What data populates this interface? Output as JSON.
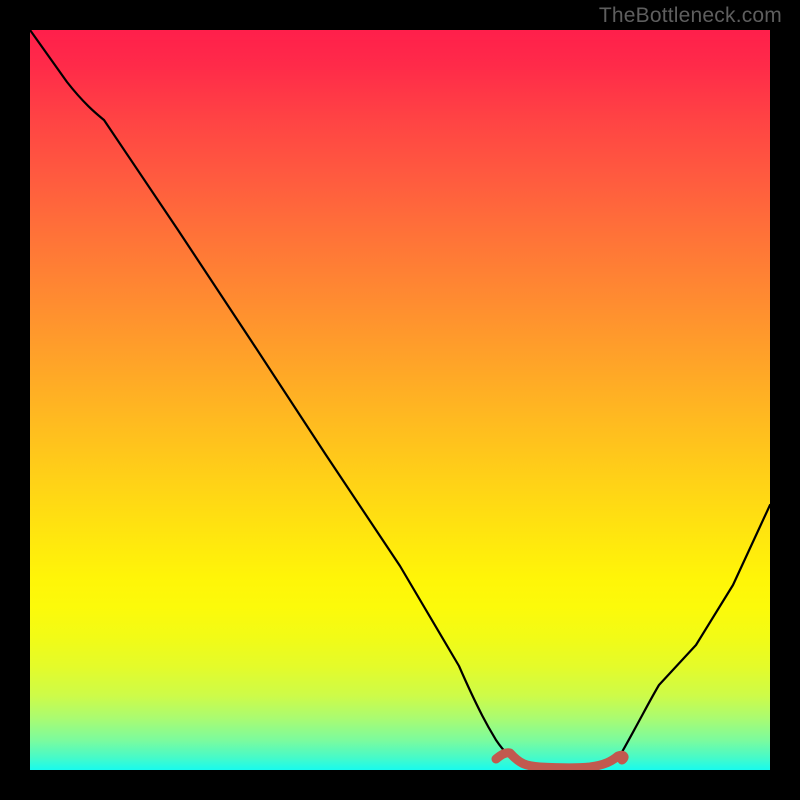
{
  "watermark": "TheBottleneck.com",
  "chart_data": {
    "type": "line",
    "title": "",
    "xlabel": "",
    "ylabel": "",
    "xlim": [
      0,
      1
    ],
    "ylim": [
      0,
      1
    ],
    "gradient_stops": [
      {
        "pos": 0.0,
        "color": "#ff1f4b"
      },
      {
        "pos": 0.5,
        "color": "#ffc01e"
      },
      {
        "pos": 0.78,
        "color": "#fdfa0a"
      },
      {
        "pos": 1.0,
        "color": "#18faee"
      }
    ],
    "series": [
      {
        "name": "bottleneck-curve",
        "color": "#000000",
        "x": [
          0.0,
          0.05,
          0.1,
          0.2,
          0.3,
          0.4,
          0.5,
          0.58,
          0.63,
          0.67,
          0.72,
          0.77,
          0.8,
          0.85,
          0.9,
          0.95,
          1.0
        ],
        "values": [
          1.0,
          0.93,
          0.89,
          0.74,
          0.59,
          0.44,
          0.29,
          0.14,
          0.05,
          0.01,
          0.0,
          0.0,
          0.01,
          0.06,
          0.15,
          0.25,
          0.36
        ]
      },
      {
        "name": "optimal-band",
        "color": "#c1594f",
        "x": [
          0.63,
          0.67,
          0.72,
          0.77,
          0.8
        ],
        "values": [
          0.012,
          0.004,
          0.003,
          0.004,
          0.012
        ]
      }
    ]
  }
}
